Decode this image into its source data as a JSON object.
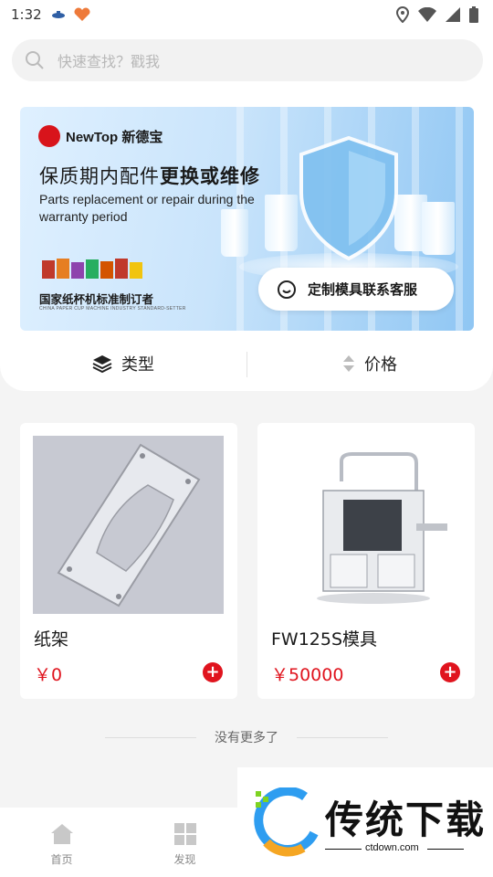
{
  "status_bar": {
    "time": "1:32"
  },
  "search": {
    "placeholder": "快速查找？戳我"
  },
  "banner": {
    "brand": "NewTop 新德宝",
    "headline_normal": "保质期内配件",
    "headline_bold": "更换或维修",
    "subline": "Parts replacement or repair during the warranty period",
    "tagline": "国家纸杯机标准制订者",
    "tagline_small": "CHINA PAPER CUP MACHINE INDUSTRY STANDARD-SETTER",
    "service_button": "定制模具联系客服"
  },
  "filters": [
    {
      "label": "类型",
      "icon": "layers-icon"
    },
    {
      "label": "价格",
      "icon": "sort-arrows-icon"
    }
  ],
  "products": [
    {
      "name": "纸架",
      "price": "￥0"
    },
    {
      "name": "FW125S模具",
      "price": "￥50000"
    }
  ],
  "list_footer": "没有更多了",
  "tabs": [
    {
      "label": "首页",
      "icon": "home-icon"
    },
    {
      "label": "发现",
      "icon": "grid-icon"
    }
  ],
  "watermark": {
    "title": "传统下载",
    "url": "ctdown.com"
  },
  "colors": {
    "accent_red": "#e0141e",
    "banner_blue": "#8fc6f3"
  }
}
